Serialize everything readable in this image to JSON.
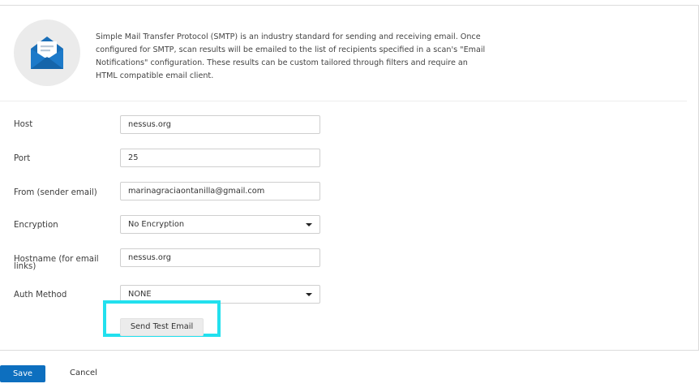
{
  "intro": {
    "icon": "envelope-open-icon",
    "lines": [
      "Simple Mail Transfer Protocol (SMTP) is an industry standard for sending and receiving email. Once",
      "configured for SMTP, scan results will be emailed to the list of recipients specified in a scan's \"Email",
      "Notifications\" configuration. These results can be custom tailored through filters and require an",
      "HTML compatible email client."
    ]
  },
  "form": {
    "host": {
      "label": "Host",
      "value": "nessus.org"
    },
    "port": {
      "label": "Port",
      "value": "25"
    },
    "from": {
      "label": "From (sender email)",
      "value": "marinagraciaontanilla@gmail.com"
    },
    "encryption": {
      "label": "Encryption",
      "value": "No Encryption"
    },
    "hostname": {
      "label_line1": "Hostname (for email",
      "label_line2": "links)",
      "value": "nessus.org"
    },
    "auth": {
      "label": "Auth Method",
      "value": "NONE"
    },
    "test_button": "Send Test Email"
  },
  "footer": {
    "save": "Save",
    "cancel": "Cancel"
  },
  "colors": {
    "primary": "#0d6fbf",
    "highlight": "#22e0ee",
    "icon_blue": "#1a6fb8"
  }
}
